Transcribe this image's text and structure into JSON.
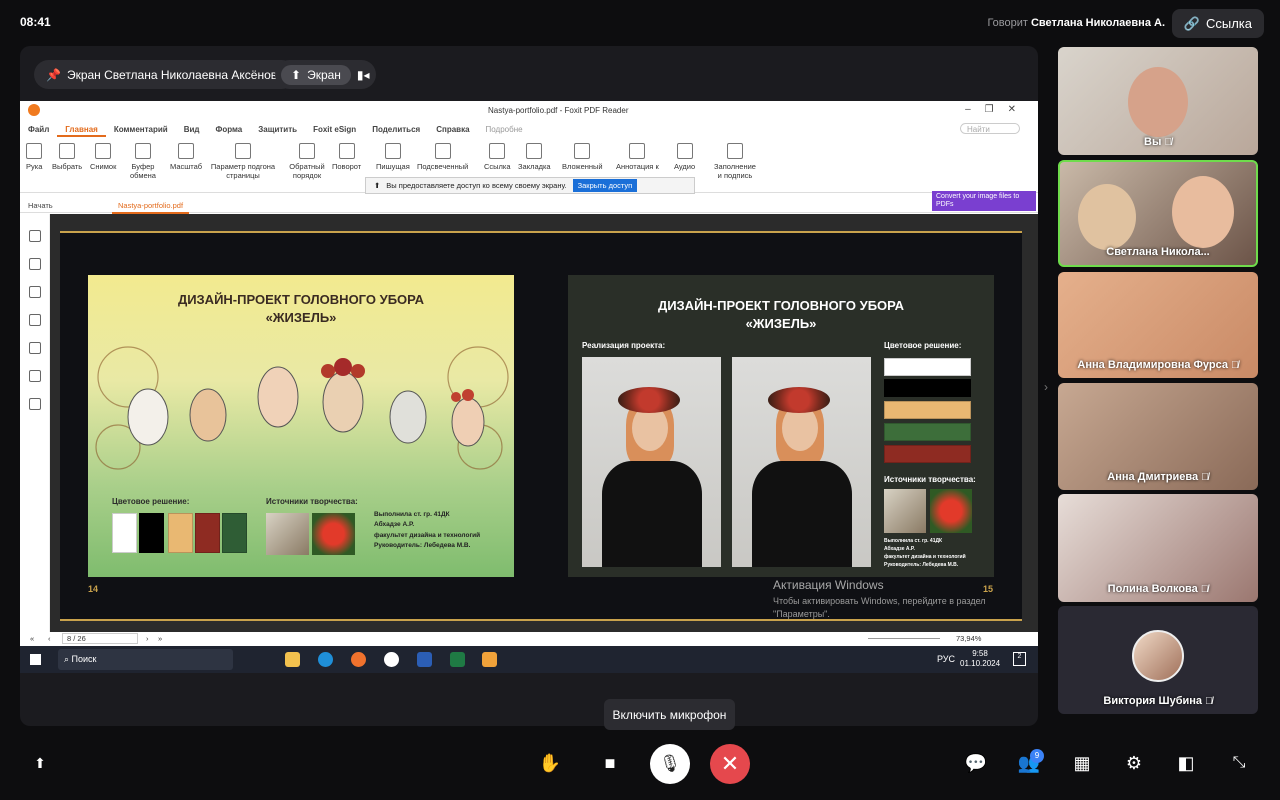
{
  "status": {
    "time": "08:41"
  },
  "header": {
    "speaking_prefix": "Говорит",
    "speaking_name": "Светлана Николаевна А.",
    "link_label": "Ссылка"
  },
  "stage": {
    "screen_pill": "Экран Светлана Николаевна Аксёнова",
    "screen_toggle": "Экран"
  },
  "app": {
    "title": "Nastya-portfolio.pdf - Foxit PDF Reader",
    "menu": [
      "Файл",
      "Главная",
      "Комментарий",
      "Вид",
      "Форма",
      "Защитить",
      "Foxit eSign",
      "Поделиться",
      "Справка",
      "Подробне"
    ],
    "search_placeholder": "Найти",
    "tools": [
      "Рука",
      "Выбрать",
      "Снимок",
      "Буфер обмена",
      "Масштаб",
      "Параметр подгона страницы",
      "Обратный порядок",
      "Поворот",
      "Пишущая",
      "Подсвеченный",
      "Ссылка",
      "Закладка",
      "Вложенный",
      "Аннотация к",
      "Аудио",
      "Заполнение и подпись"
    ],
    "share_notice": "Вы предоставляете доступ ко всему своему экрану.",
    "close_access": "Закрыть доступ",
    "tabs": [
      "Начать",
      "Nastya-portfolio.pdf"
    ],
    "promo": "Convert your image files to PDFs",
    "page_indicator": "8 / 26",
    "zoom": "73,94%"
  },
  "slides": {
    "left": {
      "title_line1": "ДИЗАЙН-ПРОЕКТ ГОЛОВНОГО УБОРА",
      "title_line2": "«ЖИЗЕЛЬ»",
      "color_label": "Цветовое решение:",
      "sources_label": "Источники творчества:",
      "credit_1": "Выполнила ст. гр. 41ДК",
      "credit_2": "Абхадзе А.Р.",
      "credit_3": "факультет дизайна и технологий",
      "credit_4": "Руководитель: Лебедева М.В.",
      "page": "14",
      "swatches": [
        "#ffffff",
        "#000000",
        "#e9b872",
        "#8e2b22",
        "#2f5d35"
      ]
    },
    "right": {
      "title_line1": "ДИЗАЙН-ПРОЕКТ ГОЛОВНОГО УБОРА",
      "title_line2": "«ЖИЗЕЛЬ»",
      "realization_label": "Реализация проекта:",
      "color_label": "Цветовое решение:",
      "sources_label": "Источники творчества:",
      "credit_1": "Выполнила ст. гр. 41ДК",
      "credit_2": "Абхадзе А.Р.",
      "credit_3": "факультет дизайна и технологий",
      "credit_4": "Руководитель: Лебедева М.В.",
      "page": "15",
      "swatches": [
        "#ffffff",
        "#000000",
        "#e9b872",
        "#3d6e3a",
        "#8e2b22"
      ]
    }
  },
  "watermark": {
    "title": "Активация Windows",
    "line1": "Чтобы активировать Windows, перейдите в раздел",
    "line2": "\"Параметры\"."
  },
  "taskbar": {
    "search": "Поиск",
    "lang": "РУС",
    "time": "9:58",
    "date": "01.10.2024",
    "notifications": "2"
  },
  "participants": [
    {
      "name": "Вы"
    },
    {
      "name": "Светлана Никола..."
    },
    {
      "name": "Анна Владимировна Фурса"
    },
    {
      "name": "Анна Дмитриева"
    },
    {
      "name": "Полина Волкова"
    },
    {
      "name": "Виктория Шубина"
    }
  ],
  "controls": {
    "mic_tooltip": "Включить микрофон",
    "participants_badge": "9"
  }
}
